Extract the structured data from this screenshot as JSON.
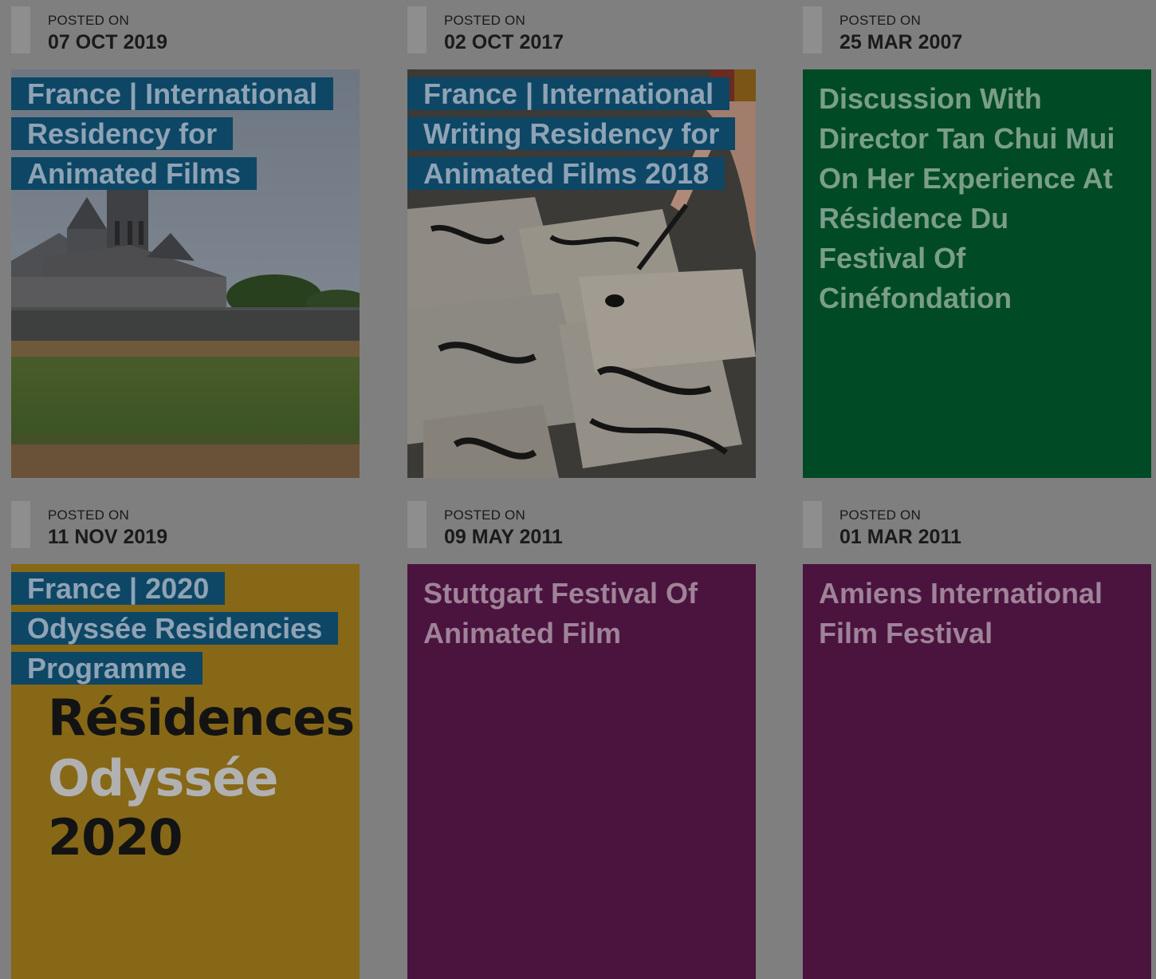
{
  "posts": [
    {
      "posted_label": "POSTED ON",
      "date": "07 OCT 2019",
      "title": "France | International Residency for Animated Films",
      "image": "castle-field-photo"
    },
    {
      "posted_label": "POSTED ON",
      "date": "02 OCT 2017",
      "title": "France | International Writing Residency for Animated Films 2018",
      "image": "ink-sketches-photo"
    },
    {
      "posted_label": "POSTED ON",
      "date": "25 MAR 2007",
      "title": "Discussion With Director Tan Chui Mui On Her Experience At Résidence Du Festival Of Cinéfondation",
      "color": "#004a25"
    },
    {
      "posted_label": "POSTED ON",
      "date": "11 NOV 2019",
      "title": "France | 2020 Odyssée Residencies Programme",
      "image": "poster",
      "poster_lines": [
        "Résidences",
        "Odyssée",
        "2020"
      ],
      "color": "#876817"
    },
    {
      "posted_label": "POSTED ON",
      "date": "09 MAY 2011",
      "title": "Stuttgart Festival Of Animated Film",
      "color": "#4a143f"
    },
    {
      "posted_label": "POSTED ON",
      "date": "01 MAR 2011",
      "title": "Amiens International Film Festival",
      "color": "#4a143f"
    }
  ],
  "colors": {
    "overlay_bg": "#7f7f7f",
    "title_highlight": "#0d4765"
  }
}
